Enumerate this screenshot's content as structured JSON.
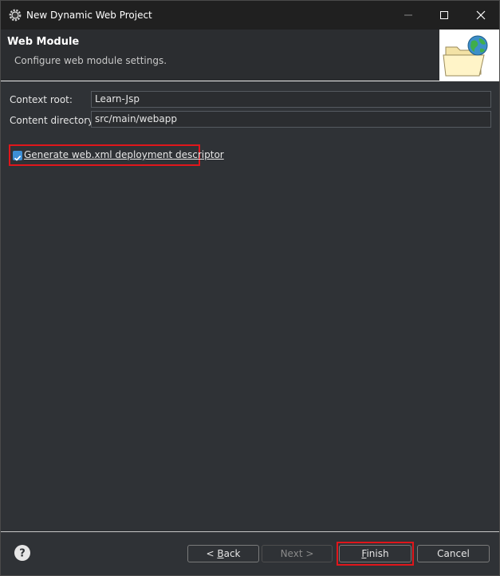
{
  "window": {
    "title": "New Dynamic Web Project",
    "controls": {
      "minimize": "minimize-icon",
      "maximize": "maximize-icon",
      "close": "close-icon"
    }
  },
  "banner": {
    "title": "Web Module",
    "description": "Configure web module settings.",
    "image": "folder-globe-icon"
  },
  "form": {
    "context_root": {
      "label": "Context root:",
      "value": "Learn-Jsp"
    },
    "content_directory": {
      "label": "Content directory:",
      "value": "src/main/webapp"
    },
    "generate_web_xml": {
      "label": "Generate web.xml deployment descriptor",
      "checked": true
    }
  },
  "footer": {
    "help_icon": "help-icon",
    "back": {
      "prefix": "< ",
      "mnemonic": "B",
      "rest": "ack"
    },
    "next": {
      "label": "Next >",
      "enabled": false
    },
    "finish": {
      "mnemonic": "F",
      "rest": "inish"
    },
    "cancel": {
      "label": "Cancel"
    }
  },
  "colors": {
    "highlight": "#e0161b",
    "checkbox_accent": "#3d8fd6",
    "dialog_bg": "#2f3236"
  }
}
